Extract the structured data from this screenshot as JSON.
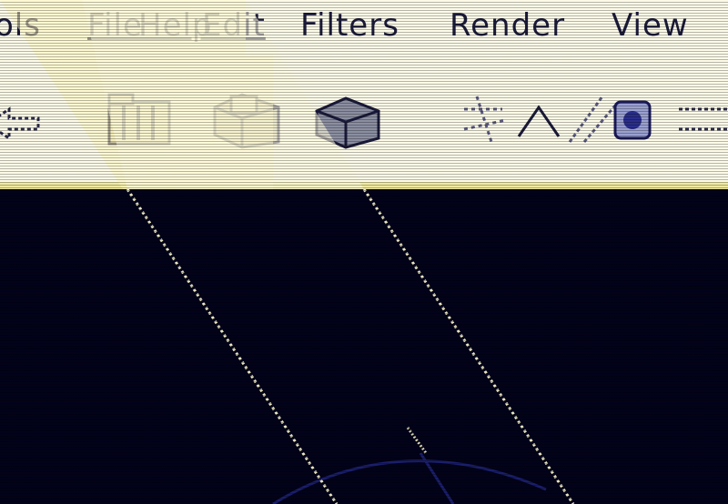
{
  "menubar": {
    "items": [
      {
        "id": "tools",
        "label": "ols"
      },
      {
        "id": "file",
        "label": "File"
      },
      {
        "id": "help",
        "label": "Help"
      },
      {
        "id": "edit",
        "label": "Edit"
      },
      {
        "id": "filters",
        "label": "Filters"
      },
      {
        "id": "render",
        "label": "Render"
      },
      {
        "id": "view",
        "label": "View"
      }
    ]
  },
  "toolbar": {
    "buttons": [
      {
        "id": "prev",
        "icon": "arrow-icon"
      },
      {
        "id": "open",
        "icon": "folder-open-icon"
      },
      {
        "id": "save",
        "icon": "save-disk-icon"
      },
      {
        "id": "print",
        "icon": "printer-icon"
      },
      {
        "id": "scene",
        "icon": "scene-icon"
      },
      {
        "id": "run",
        "icon": "render-run-icon"
      },
      {
        "id": "next",
        "icon": "arrow-icon"
      }
    ]
  },
  "colors": {
    "menu_background": "#fdfbe8",
    "toolbar_border": "#f0e9a0",
    "workspace_background": "#02021a",
    "text": "#1a1a3a",
    "glare": "#fff7c0"
  }
}
